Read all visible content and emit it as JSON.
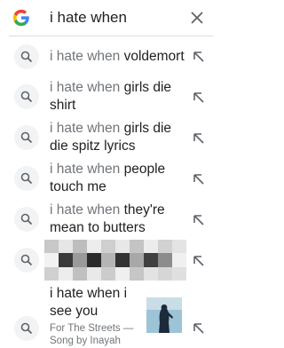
{
  "search": {
    "query": "i hate when"
  },
  "suggestions": [
    {
      "prefix": "i hate when",
      "completion": "voldemort"
    },
    {
      "prefix": "i hate when",
      "completion": "girls die shirt"
    },
    {
      "prefix": "i hate when",
      "completion": "girls die die spitz lyrics"
    },
    {
      "prefix": "i hate when",
      "completion": "people touch me"
    },
    {
      "prefix": "i hate when",
      "completion": "they're mean to butters"
    }
  ],
  "song_suggestion": {
    "title": "i hate when i see you",
    "subtitle_1": "For The Streets —",
    "subtitle_2": "Song by Inayah"
  },
  "icons": {
    "logo": "google-g-icon",
    "clear": "close-icon",
    "row": "search-icon",
    "fill": "arrow-up-left-icon"
  },
  "colors": {
    "text": "#202124",
    "muted": "#70757a",
    "icon_bg": "#f1f3f4",
    "divider": "#dadce0"
  }
}
